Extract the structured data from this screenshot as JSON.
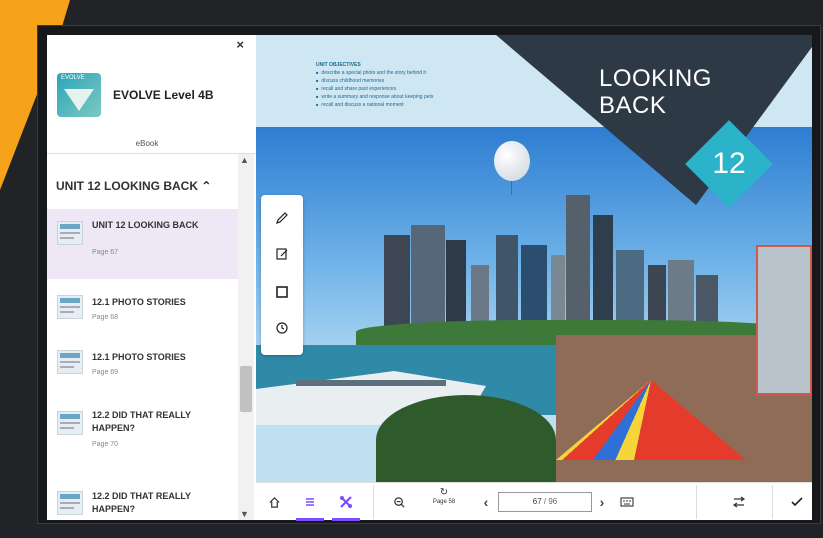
{
  "sidebar": {
    "close_label": "×",
    "brand_logo_text": "EVOLVE",
    "brand_title": "EVOLVE Level 4B",
    "ebook_label": "eBook",
    "unit_header": "UNIT 12 LOOKING BACK",
    "items": [
      {
        "title": "UNIT 12 LOOKING BACK",
        "page": "Page 67",
        "active": true
      },
      {
        "title": "12.1 PHOTO STORIES",
        "page": "Page 68",
        "active": false
      },
      {
        "title": "12.1 PHOTO STORIES",
        "page": "Page 69",
        "active": false
      },
      {
        "title": "12.2 DID THAT REALLY HAPPEN?",
        "page": "Page 70",
        "active": false
      },
      {
        "title": "12.2 DID THAT REALLY HAPPEN?",
        "page": "",
        "active": false
      }
    ]
  },
  "page": {
    "objectives_title": "UNIT OBJECTIVES",
    "objectives": [
      "describe a special photo and the story behind it",
      "discuss childhood memories",
      "recall and share past experiences",
      "write a summary and response about keeping pets",
      "recall and discuss a national moment"
    ],
    "unit_title_line1": "LOOKING",
    "unit_title_line2": "BACK",
    "unit_number": "12"
  },
  "toolbar": {
    "zoom_out_label": "⊖",
    "rotate_label": "Page 58",
    "current_page": "67",
    "page_separator": " / ",
    "total_pages": "96",
    "prev_label": "‹",
    "next_label": "›"
  },
  "colors": {
    "accent": "#7c4dff",
    "active_item_bg": "#ede7f6",
    "diamond": "#2bb3c9",
    "dark_panel": "#2d3a45",
    "orange": "#f6a31b"
  }
}
